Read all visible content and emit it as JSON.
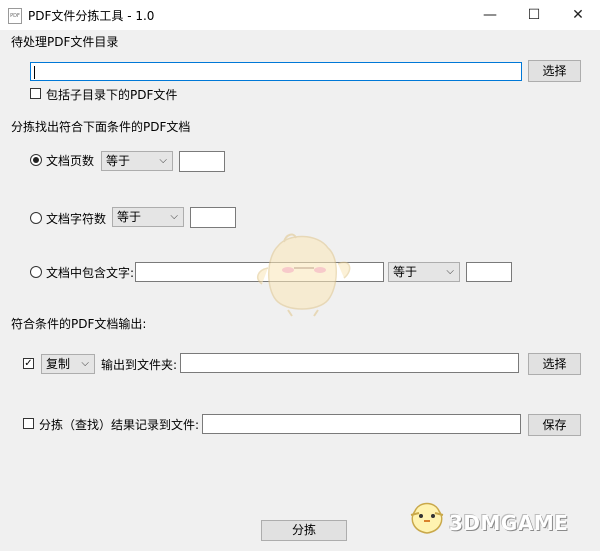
{
  "window": {
    "title": "PDF文件分拣工具 - 1.0",
    "app_icon_text": "PDF",
    "minimize_glyph": "—",
    "maximize_glyph": "☐",
    "close_glyph": "✕"
  },
  "source": {
    "section_label": "待处理PDF文件目录",
    "path_value": "",
    "browse_label": "选择",
    "include_subdirs_label": "包括子目录下的PDF文件",
    "include_subdirs_checked": false
  },
  "filter": {
    "section_label": "分拣找出符合下面条件的PDF文档",
    "page_count": {
      "label": "文档页数",
      "selected": true,
      "op": "等于",
      "value": ""
    },
    "char_count": {
      "label": "文档字符数",
      "selected": false,
      "op": "等于",
      "value": ""
    },
    "contains_text": {
      "label": "文档中包含文字:",
      "selected": false,
      "text": "",
      "op": "等于",
      "value": ""
    },
    "dropdown_arrow": "⌵"
  },
  "output": {
    "section_label": "符合条件的PDF文档输出:",
    "enabled_checked": true,
    "action": "复制",
    "dest_label": "输出到文件夹:",
    "dest_value": "",
    "browse_label": "选择",
    "log_checked": false,
    "log_label": "分拣（查找）结果记录到文件:",
    "log_value": "",
    "save_label": "保存"
  },
  "run_label": "分拣",
  "watermark": {
    "text": "3DMGAME"
  },
  "colors": {
    "focus_border": "#0078d7",
    "window_bg": "#f0f0f0"
  }
}
